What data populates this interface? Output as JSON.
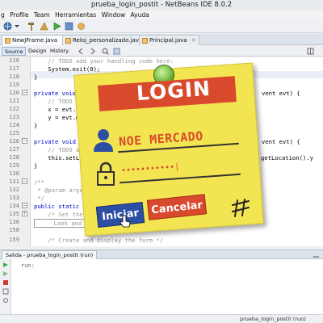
{
  "window": {
    "title": "prueba_login_postit - NetBeans IDE 8.0.2"
  },
  "menu": {
    "items": [
      "g",
      "Profile",
      "Team",
      "Herramientas",
      "Window",
      "Ayuda"
    ]
  },
  "tabs": [
    {
      "label": "NewJFrame.java"
    },
    {
      "label": "Reloj_personalizado.java"
    },
    {
      "label": "Principal.java"
    }
  ],
  "editor_toolbar": {
    "source": "Source",
    "design": "Design",
    "history": "History"
  },
  "code": {
    "lines": [
      {
        "n": "116",
        "text": "    // TODO add your handling code here:",
        "style": "comment"
      },
      {
        "n": "117",
        "text": "    System.exit(0);",
        "style": ""
      },
      {
        "n": "118",
        "text": "}",
        "style": ""
      },
      {
        "n": "119",
        "text": "",
        "style": ""
      },
      {
        "n": "120",
        "text": "private void ",
        "style": "kw"
      },
      {
        "n": "121",
        "text": "    // TODO a",
        "style": "comment"
      },
      {
        "n": "122",
        "text": "    x = evt.g",
        "style": ""
      },
      {
        "n": "123",
        "text": "    y = evt.g",
        "style": ""
      },
      {
        "n": "124",
        "text": "}",
        "style": ""
      },
      {
        "n": "125",
        "text": "",
        "style": ""
      },
      {
        "n": "126",
        "text": "private void ",
        "style": "kw"
      },
      {
        "n": "127",
        "text": "    // TODO a",
        "style": "comment"
      },
      {
        "n": "128",
        "text": "    this.setLo",
        "style": ""
      },
      {
        "n": "129",
        "text": "}",
        "style": ""
      },
      {
        "n": "130",
        "text": "",
        "style": ""
      },
      {
        "n": "131",
        "text": "/**",
        "style": "comment"
      },
      {
        "n": "132",
        "text": " * @param args",
        "style": "comment"
      },
      {
        "n": "133",
        "text": " */",
        "style": "comment"
      },
      {
        "n": "134",
        "text": "public static v",
        "style": "kw"
      },
      {
        "n": "135",
        "text": "    /* Set the",
        "style": "comment"
      },
      {
        "n": "136",
        "text": "     Look and f",
        "style": "comment"
      },
      {
        "n": "158",
        "text": "",
        "style": ""
      },
      {
        "n": "159",
        "text": "    /* Create and display the form */",
        "style": "comment"
      }
    ],
    "right_fragments": {
      "l120": "vent evt) {",
      "l126": "vent evt) {",
      "l128": "is.getLocation().y"
    }
  },
  "note": {
    "title": "LOGIN",
    "username": "NOE MERCADO",
    "password_mask": "•••••••••••|",
    "login_button": "Iniciar",
    "cancel_button": "Cancelar"
  },
  "output": {
    "tab_label": "Salida - prueba_login_postit (run)",
    "text": "run:"
  },
  "status": {
    "project": "prueba_login_postit (run)",
    "position": "..."
  }
}
